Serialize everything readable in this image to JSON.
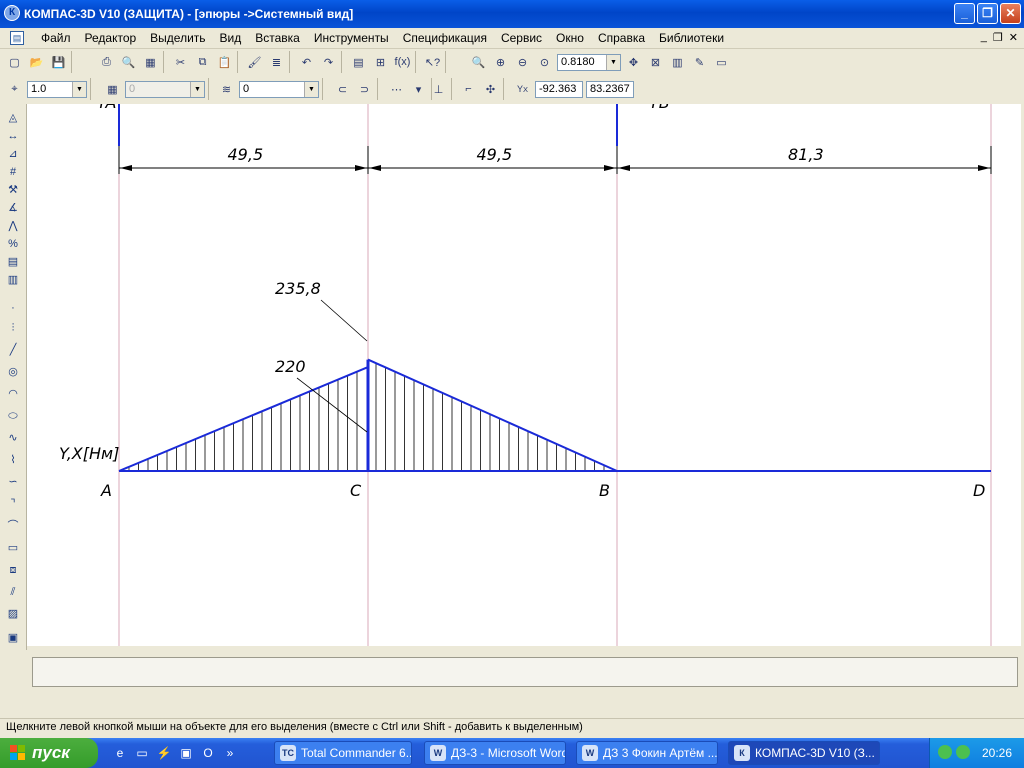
{
  "window": {
    "title": "КОМПАС-3D V10 (ЗАЩИТА) - [эпюры ->Системный вид]",
    "app_icon": "К"
  },
  "menu": [
    "Файл",
    "Редактор",
    "Выделить",
    "Вид",
    "Вставка",
    "Инструменты",
    "Спецификация",
    "Сервис",
    "Окно",
    "Справка",
    "Библиотеки"
  ],
  "toolbar1": {
    "zoom_value": "0.8180"
  },
  "toolbar2": {
    "scale_value": "1.0",
    "layer_value": "0",
    "state_value": "0",
    "coord_x": "-92.363",
    "coord_y": "83.2367",
    "coord_label": "Y",
    "coord_sub": "X"
  },
  "chart_data": {
    "type": "area",
    "points": [
      "A",
      "C",
      "B",
      "D"
    ],
    "spans": [
      {
        "from": "A",
        "to": "C",
        "label": "49,5"
      },
      {
        "from": "C",
        "to": "B",
        "label": "49,5"
      },
      {
        "from": "B",
        "to": "D",
        "label": "81,3"
      }
    ],
    "moment_values": [
      {
        "x_point": "A",
        "value": 0
      },
      {
        "x_point": "C",
        "value": 220
      },
      {
        "x_point": "C",
        "value": 235.8
      },
      {
        "x_point": "B",
        "value": 0
      },
      {
        "x_point": "D",
        "value": 0
      }
    ],
    "value_labels": [
      "235,8",
      "220"
    ],
    "ylabel": "Y,X[Нм]",
    "reaction_labels": [
      "YA",
      "YB"
    ],
    "line_color": "#1a2ad8"
  },
  "statusbar": {
    "hint": "Щелкните левой кнопкой мыши на объекте для его выделения (вместе с Ctrl или Shift - добавить к выделенным)"
  },
  "taskbar": {
    "start_label": "пуск",
    "tasks": [
      {
        "label": "Total Commander 6....",
        "icon": "TC"
      },
      {
        "label": "ДЗ-3 - Microsoft Word",
        "icon": "W"
      },
      {
        "label": "ДЗ 3 Фокин Артём ...",
        "icon": "W"
      },
      {
        "label": "КОМПАС-3D V10 (З...",
        "icon": "К"
      }
    ],
    "clock": "20:26"
  }
}
